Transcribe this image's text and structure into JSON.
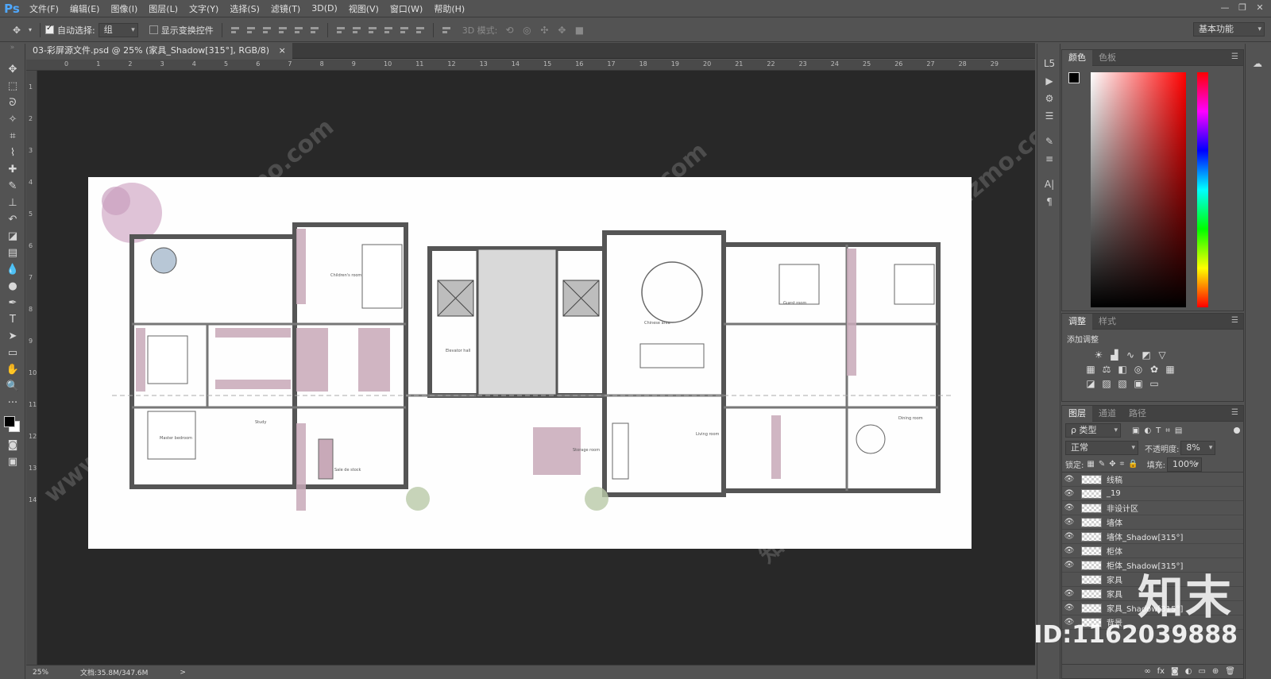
{
  "app": {
    "logo": "Ps"
  },
  "menu": [
    "文件(F)",
    "编辑(E)",
    "图像(I)",
    "图层(L)",
    "文字(Y)",
    "选择(S)",
    "滤镜(T)",
    "3D(D)",
    "视图(V)",
    "窗口(W)",
    "帮助(H)"
  ],
  "options": {
    "auto_select_label": "自动选择:",
    "auto_select_value": "组",
    "show_transform_label": "显示变换控件",
    "mode3d_label": "3D 模式:",
    "workspace": "基本功能"
  },
  "document": {
    "tab_title": "03-彩屏源文件.psd @ 25% (家具_Shadow[315°], RGB/8)",
    "close": "×"
  },
  "ruler_top": [
    "0",
    "1",
    "2",
    "3",
    "4",
    "5",
    "6",
    "7",
    "8",
    "9",
    "10",
    "11",
    "12",
    "13",
    "14",
    "15",
    "16",
    "17",
    "18",
    "19",
    "20",
    "21",
    "22",
    "23",
    "24",
    "25",
    "26",
    "27",
    "28",
    "29"
  ],
  "ruler_left": [
    "1",
    "2",
    "3",
    "4",
    "5",
    "6",
    "7",
    "8",
    "9",
    "10",
    "11",
    "12",
    "13",
    "14"
  ],
  "status": {
    "zoom": "25%",
    "doc_info": "文档:35.8M/347.6M",
    "arrow": ">"
  },
  "floorplan": {
    "room_labels": [
      "Master bedroom",
      "Children's room",
      "Chinese area",
      "Guest room",
      "Elevator hall",
      "Sale de stock",
      "Study",
      "Living room",
      "Storage room",
      "Dining room"
    ]
  },
  "color_panel": {
    "tabs": [
      "颜色",
      "色板"
    ]
  },
  "adjust_panel": {
    "tabs": [
      "调整",
      "样式"
    ],
    "add_label": "添加调整"
  },
  "layers_panel": {
    "tabs": [
      "图层",
      "通道",
      "路径"
    ],
    "filter_label": "ρ 类型",
    "blend_mode": "正常",
    "opacity_label": "不透明度:",
    "opacity_value": "8%",
    "lock_label": "锁定:",
    "fill_label": "填充:",
    "fill_value": "100%",
    "layers": [
      {
        "name": "线稿",
        "visible": true
      },
      {
        "name": "_19",
        "visible": true
      },
      {
        "name": "非设计区",
        "visible": true
      },
      {
        "name": "墙体",
        "visible": true
      },
      {
        "name": "墙体_Shadow[315°]",
        "visible": true
      },
      {
        "name": "柜体",
        "visible": true
      },
      {
        "name": "柜体_Shadow[315°]",
        "visible": true
      },
      {
        "name": "家具",
        "visible": false
      },
      {
        "name": "家具",
        "visible": true
      },
      {
        "name": "家具_Shadow[315°]",
        "visible": true
      },
      {
        "name": "背景",
        "visible": true
      }
    ]
  },
  "watermarks": {
    "brand": "知末",
    "id": "ID:1162039888",
    "site": "www.znzmo.com",
    "site_cn": "知末网"
  }
}
